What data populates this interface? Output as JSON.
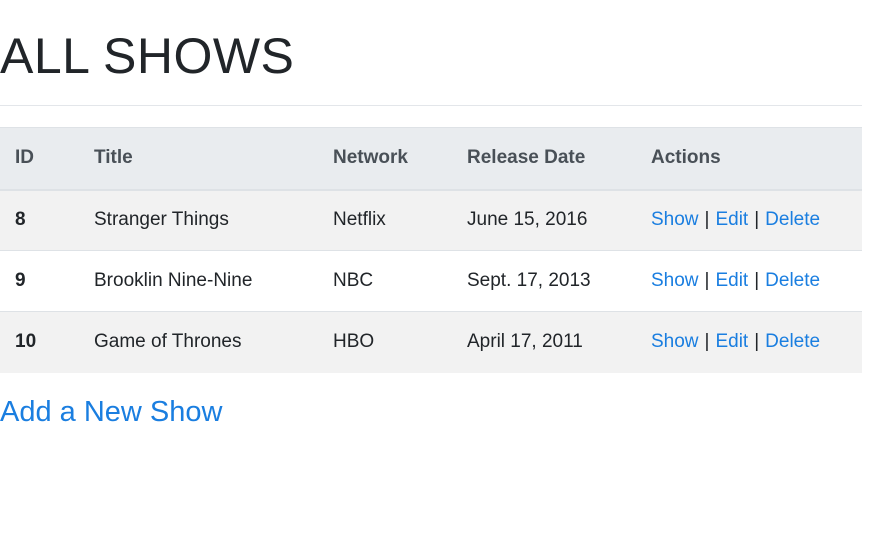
{
  "page": {
    "title": "ALL SHOWS"
  },
  "table": {
    "headers": {
      "id": "ID",
      "title": "Title",
      "network": "Network",
      "release_date": "Release Date",
      "actions": "Actions"
    },
    "rows": [
      {
        "id": "8",
        "title": "Stranger Things",
        "network": "Netflix",
        "release_date": "June 15, 2016"
      },
      {
        "id": "9",
        "title": "Brooklin Nine-Nine",
        "network": "NBC",
        "release_date": "Sept. 17, 2013"
      },
      {
        "id": "10",
        "title": "Game of Thrones",
        "network": "HBO",
        "release_date": "April 17, 2011"
      }
    ],
    "actions": {
      "show": "Show",
      "edit": "Edit",
      "delete": "Delete",
      "separator": "|"
    }
  },
  "add_link": "Add a New Show",
  "colors": {
    "link": "#1a7ee0",
    "header_bg": "#e9ecef",
    "stripe_bg": "#f2f2f2"
  }
}
